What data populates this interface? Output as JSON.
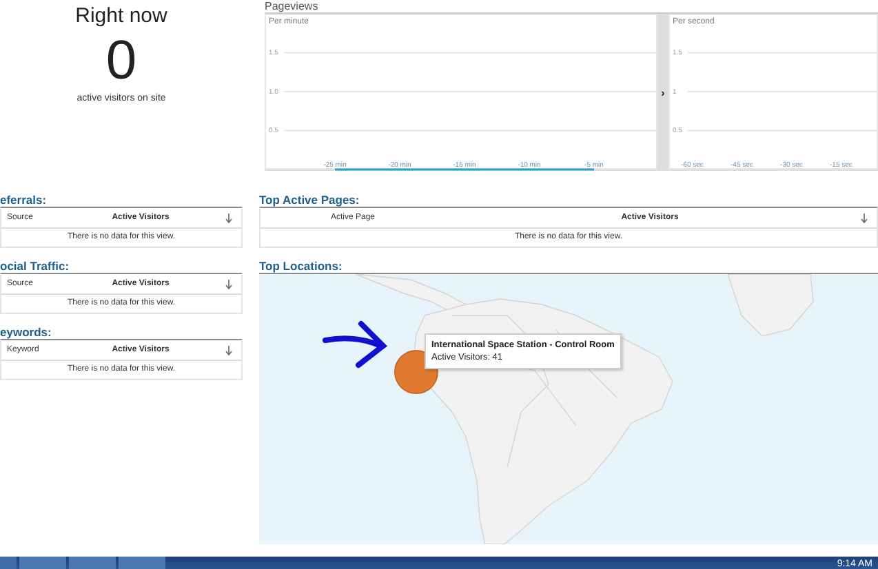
{
  "right_now": {
    "title": "Right now",
    "count": "0",
    "caption": "active visitors on site"
  },
  "pageviews": {
    "title": "Pageviews",
    "expand_glyph": "›",
    "panels": [
      {
        "label": "Per minute",
        "chart_data": {
          "type": "line",
          "categories": [
            "-25 min",
            "-20 min",
            "-15 min",
            "-10 min",
            "-5 min"
          ],
          "ylim": [
            0,
            2
          ],
          "grid": true,
          "yticks": [
            0.5,
            {
              "value": 1.0,
              "label": "1.0"
            },
            1.5
          ],
          "values": [
            0,
            0,
            0,
            0,
            0
          ]
        }
      },
      {
        "label": "Per second",
        "chart_data": {
          "type": "bar",
          "categories": [
            "-60 sec",
            "-45 sec",
            "-30 sec",
            "-15 sec"
          ],
          "ylim": [
            0,
            2
          ],
          "grid": true,
          "yticks": [
            0.5,
            1,
            1.5
          ],
          "values": [
            null,
            null,
            null,
            null
          ]
        }
      }
    ]
  },
  "left_tables": [
    {
      "title": "eferrals:",
      "columns": [
        "Source",
        "Active Visitors"
      ],
      "empty_message": "There is no data for this view."
    },
    {
      "title": "ocial Traffic:",
      "columns": [
        "Source",
        "Active Visitors"
      ],
      "empty_message": "There is no data for this view."
    },
    {
      "title": "eywords:",
      "columns": [
        "Keyword",
        "Active Visitors"
      ],
      "empty_message": "There is no data for this view."
    }
  ],
  "top_pages": {
    "title": "Top Active Pages:",
    "columns": [
      "Active Page",
      "Active Visitors"
    ],
    "empty_message": "There is no data for this view."
  },
  "top_locations": {
    "title": "Top Locations:",
    "tooltip": {
      "title": "International Space Station - Control Room",
      "detail": "Active Visitors: 41"
    }
  },
  "taskbar": {
    "clock": "9:14 AM"
  }
}
